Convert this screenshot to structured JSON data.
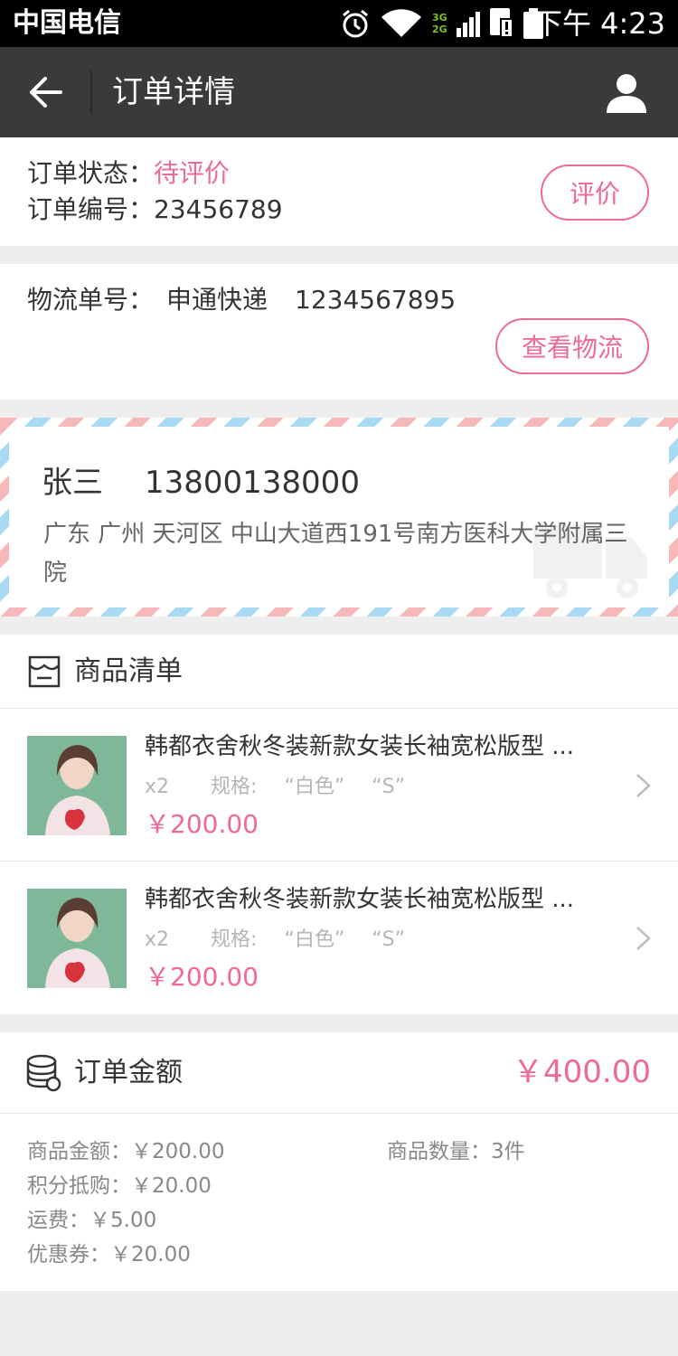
{
  "status_bar": {
    "carrier": "中国电信",
    "network_label_top": "3G",
    "network_label_bottom": "2G",
    "time": "下午 4:23",
    "icons": [
      "alarm-icon",
      "wifi-icon",
      "signal-icon",
      "sim-alert-icon",
      "battery-icon"
    ]
  },
  "nav": {
    "title": "订单详情",
    "back_icon": "arrow-left-icon",
    "user_icon": "user-icon"
  },
  "order": {
    "status_label": "订单状态：",
    "status_value": "待评价",
    "number_label": "订单编号：",
    "number_value": "23456789",
    "review_button": "评价"
  },
  "logistics": {
    "label": "物流单号：",
    "company": "申通快递",
    "tracking_no": "1234567895",
    "view_button": "查看物流"
  },
  "address": {
    "name": "张三",
    "phone": "13800138000",
    "detail": "广东 广州 天河区 中山大道西191号南方医科大学附属三院",
    "truck_icon": "truck-icon"
  },
  "goods": {
    "header_label": "商品清单",
    "header_icon": "shop-icon",
    "items": [
      {
        "name": "韩都衣舍秋冬装新款女装长袖宽松版型 ...",
        "qty": "x2",
        "spec_label": "规格:",
        "spec_color": "“白色”",
        "spec_size": "“S”",
        "price": "￥200.00"
      },
      {
        "name": "韩都衣舍秋冬装新款女装长袖宽松版型 ...",
        "qty": "x2",
        "spec_label": "规格:",
        "spec_color": "“白色”",
        "spec_size": "“S”",
        "price": "￥200.00"
      }
    ]
  },
  "amount": {
    "header_label": "订单金额",
    "header_icon": "coins-icon",
    "total": "￥400.00",
    "goods_amount": "商品金额：￥200.00",
    "goods_count": "商品数量：3件",
    "points": "积分抵购：￥20.00",
    "shipping": "运费：￥5.00",
    "coupon": "优惠券：￥20.00"
  },
  "colors": {
    "accent": "#f0679a",
    "navbar": "#3a3a3c",
    "statusbar": "#000000",
    "background": "#eeeeef"
  }
}
